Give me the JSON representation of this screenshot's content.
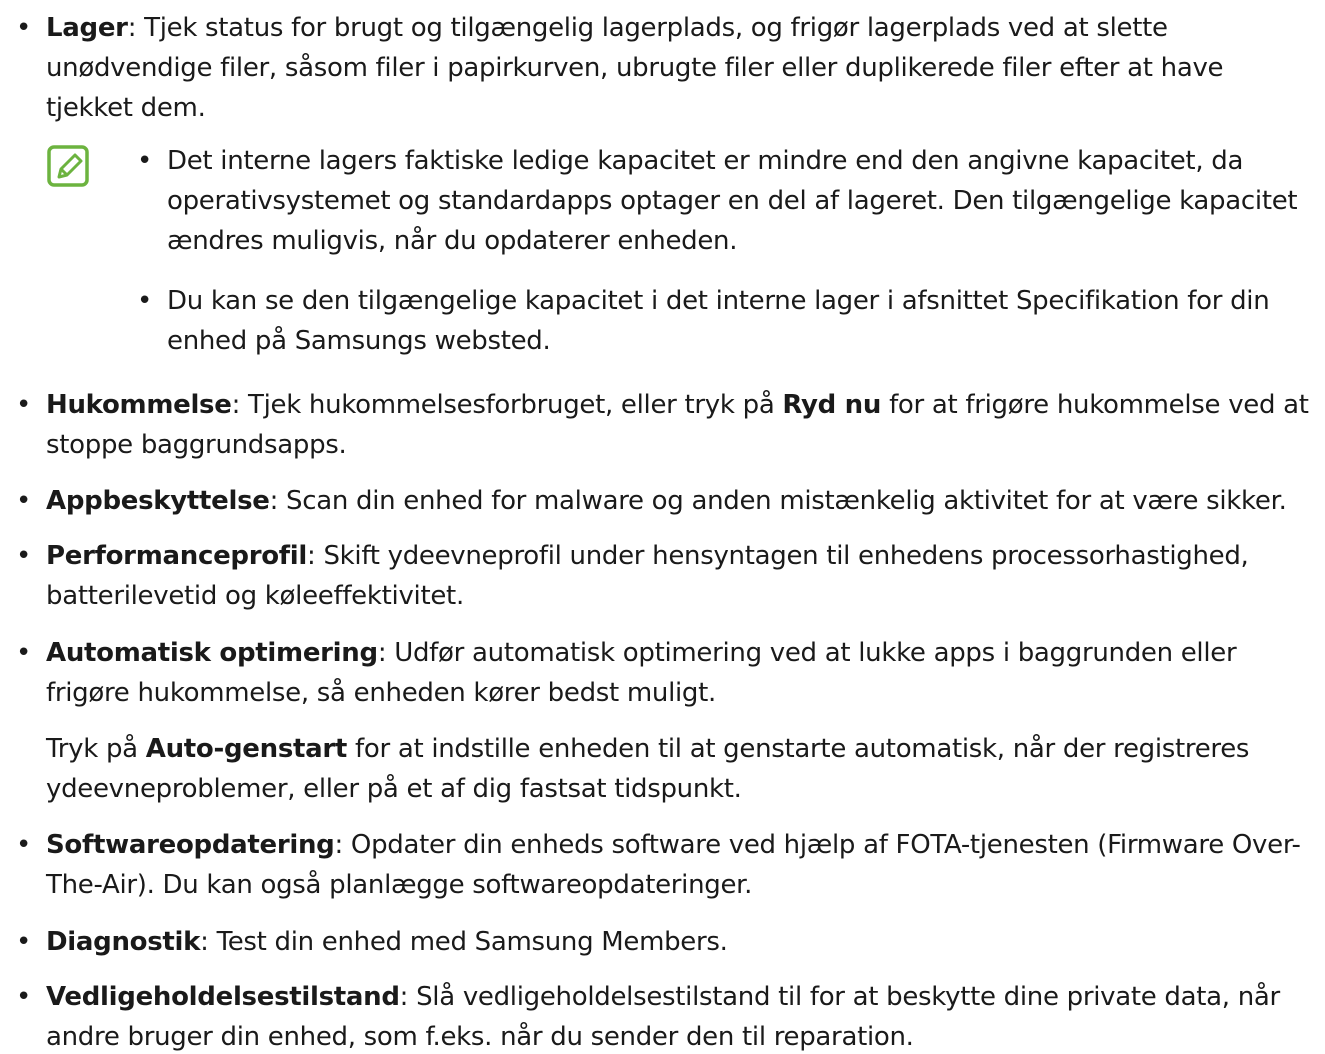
{
  "bullet_char": "•",
  "items": [
    {
      "term": "Lager",
      "text": ": Tjek status for brugt og tilgængelig lagerplads, og frigør lagerplads ved at slette unødvendige filer, såsom filer i papirkurven, ubrugte filer eller duplikerede filer efter at have tjekket dem."
    },
    {
      "term": "Hukommelse",
      "text_before": ": Tjek hukommelsesforbruget, eller tryk på ",
      "bold": "Ryd nu",
      "text_after": " for at frigøre hukommelse ved at stoppe baggrundsapps."
    },
    {
      "term": "Appbeskyttelse",
      "text": ": Scan din enhed for malware og anden mistænkelig aktivitet for at være sikker."
    },
    {
      "term": "Performanceprofil",
      "text": ": Skift ydeevneprofil under hensyntagen til enhedens processorhastighed, batterilevetid og køleeffektivitet."
    },
    {
      "term": "Automatisk optimering",
      "text": ": Udfør automatisk optimering ved at lukke apps i baggrunden eller frigøre hukommelse, så enheden kører bedst muligt."
    },
    {
      "term": "Softwareopdatering",
      "text": ": Opdater din enheds software ved hjælp af FOTA-tjenesten (Firmware Over-The-Air). Du kan også planlægge softwareopdateringer."
    },
    {
      "term": "Diagnostik",
      "text": ": Test din enhed med Samsung Members."
    },
    {
      "term": "Vedligeholdelsestilstand",
      "text": ": Slå vedligeholdelsestilstand til for at beskytte dine private data, når andre bruger din enhed, som f.eks. når du sender den til reparation."
    }
  ],
  "note": {
    "icon": "note-pencil-icon",
    "icon_color": "#6cb33f",
    "items": [
      "Det interne lagers faktiske ledige kapacitet er mindre end den angivne kapacitet, da operativsystemet og standardapps optager en del af lageret. Den tilgængelige kapacitet ændres muligvis, når du opdaterer enheden.",
      "Du kan se den tilgængelige kapacitet i det interne lager i afsnittet Specifikation for din enhed på Samsungs websted."
    ]
  },
  "auto_restart_para": {
    "text_before": "Tryk på ",
    "bold": "Auto-genstart",
    "text_after": " for at indstille enheden til at genstarte automatisk, når der registreres ydeevneproblemer, eller på et af dig fastsat tidspunkt."
  }
}
